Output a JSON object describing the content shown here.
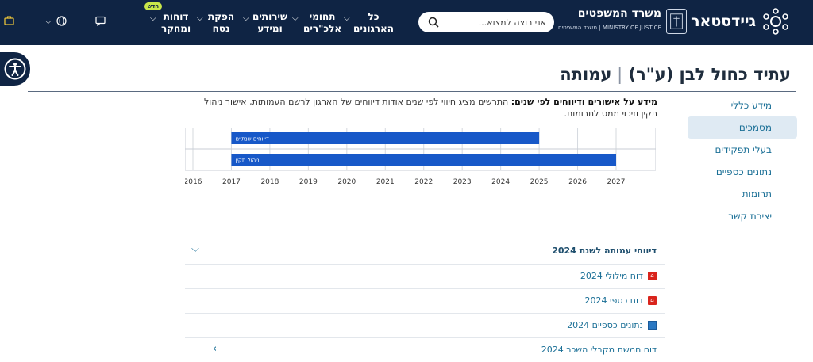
{
  "header": {
    "brand_name": "גיידסטאר",
    "ministry_title": "משרד המשפטים",
    "ministry_subtitle": "MINISTRY OF JUSTICE | משרד המשפטים",
    "search_placeholder": "אני רוצה למצוא...",
    "nav": [
      {
        "line1": "כל",
        "line2": "הארגונים"
      },
      {
        "line1": "תחומי",
        "line2": "אלכ\"רים"
      },
      {
        "line1": "שירותים",
        "line2": "ומידע"
      },
      {
        "line1": "הפקת",
        "line2": "נסח"
      },
      {
        "line1": "דוחות",
        "line2": "ומחקר"
      }
    ],
    "new_badge": "חדש",
    "icons": [
      "globe-icon",
      "message-icon",
      "briefcase-icon"
    ]
  },
  "page": {
    "org_name": "עתיד כחול לבן (ע\"ר)",
    "org_type": "עמותה"
  },
  "sidenav": {
    "items": [
      {
        "label": "מידע כללי"
      },
      {
        "label": "מסמכים"
      },
      {
        "label": "בעלי תפקידים"
      },
      {
        "label": "נתונים כספיים"
      },
      {
        "label": "תרומות"
      },
      {
        "label": "יצירת קשר"
      }
    ]
  },
  "info": {
    "bold": "מידע על אישורים ודיווחים לפי שנים:",
    "text": " התרשים מציג חיווי לפי שנים אודות דיווחים של הארגון לרשם העמותות, אישור ניהול תקין וזיכוי ממס לתרומות."
  },
  "chart_data": {
    "type": "bar",
    "orientation": "horizontal",
    "categories": [
      "דיווחים שנתיים",
      "ניהול תקין"
    ],
    "series": [
      {
        "values": [
          [
            2017,
            2025
          ],
          [
            2017,
            2027
          ]
        ]
      }
    ],
    "x_ticks": [
      "2016",
      "2017",
      "2018",
      "2019",
      "2020",
      "2021",
      "2022",
      "2023",
      "2024",
      "2025",
      "2026",
      "2027"
    ],
    "xlim": [
      2016,
      2027
    ],
    "bar_color": "#1758c8",
    "grid": true
  },
  "documents": {
    "header_label": "דיווחי עמותה לשנת 2024",
    "rows": [
      {
        "label": "דוח מילולי 2024",
        "icon": "pdf-icon"
      },
      {
        "label": "דוח כספי 2024",
        "icon": "pdf-icon"
      },
      {
        "label": "נתונים כספיים 2024",
        "icon": "excel-icon"
      },
      {
        "label": "דוח חמשת מקבלי השכר 2024",
        "icon": ""
      }
    ]
  },
  "colors": {
    "header_bg": "#0f2444",
    "accent": "#1a6f96",
    "badge": "#c8e64a",
    "bar": "#1758c8"
  }
}
